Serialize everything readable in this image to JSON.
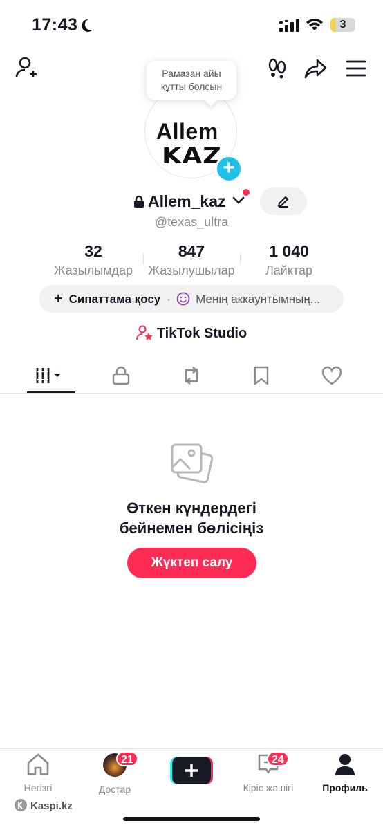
{
  "status_bar": {
    "time": "17:43",
    "battery": "3"
  },
  "profile": {
    "tooltip_line1": "Рамазан айы",
    "tooltip_line2": "құтты болсын",
    "avatar_text_line1": "Allem",
    "avatar_text_line2": "KAZ",
    "username": "Allem_kaz",
    "handle": "@texas_ultra"
  },
  "stats": [
    {
      "value": "32",
      "label": "Жазылымдар"
    },
    {
      "value": "847",
      "label": "Жазылушылар"
    },
    {
      "value": "1 040",
      "label": "Лайктар"
    }
  ],
  "bio": {
    "add_label": "Сипаттама қосу",
    "separator": "·",
    "account_text": "Менің аккаунтымның..."
  },
  "studio_label": "TikTok Studio",
  "empty_state": {
    "title_line1": "Өткен күндердегі",
    "title_line2": "бейнемен бөлісіңіз",
    "button": "Жүктеп салу"
  },
  "nav": {
    "home": "Негізгі",
    "friends": "Достар",
    "friends_badge": "21",
    "inbox": "Кіріс жәшігі",
    "inbox_badge": "24",
    "profile": "Профиль"
  },
  "watermark": "Kaspi.kz",
  "colors": {
    "accent": "#fe2c55",
    "avatar_plus": "#20c1e6",
    "text": "#161823",
    "muted": "#8a8b91"
  }
}
